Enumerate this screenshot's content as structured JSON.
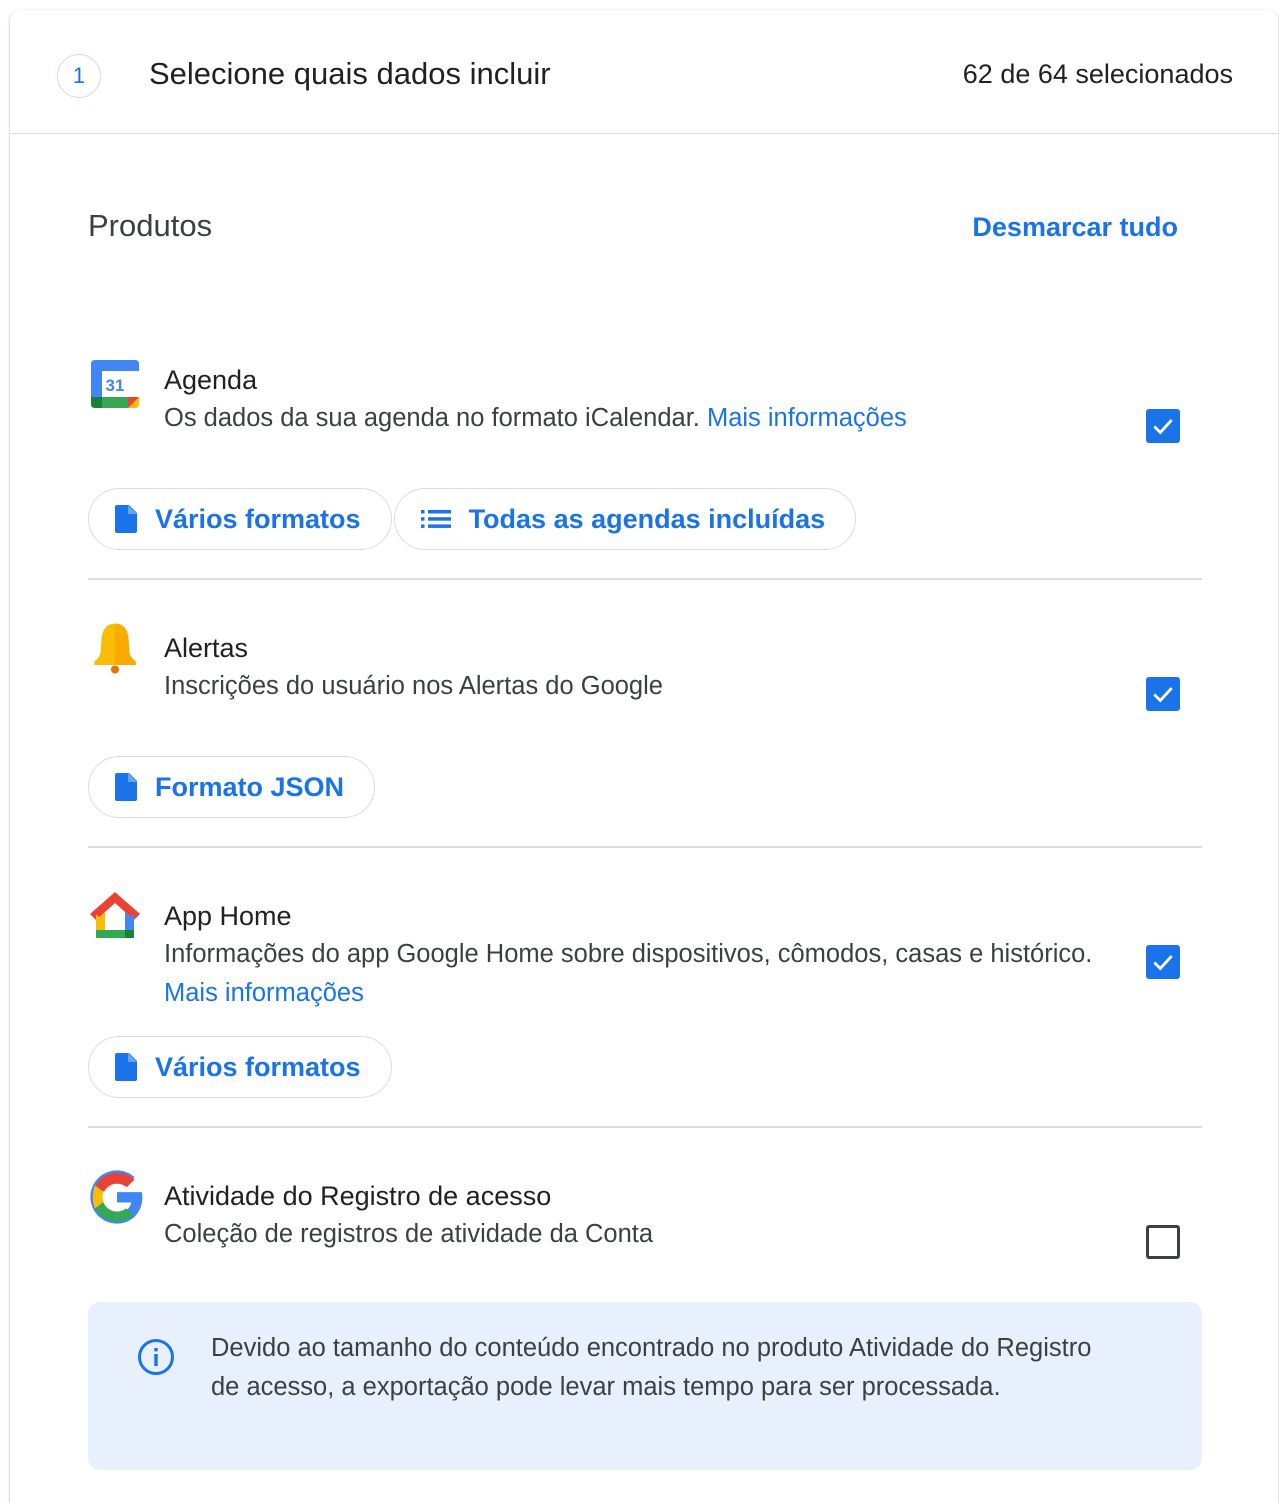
{
  "step": {
    "number": "1",
    "title": "Selecione quais dados incluir",
    "count": "62 de 64 selecionados"
  },
  "products_section": {
    "heading": "Produtos",
    "deselect_all": "Desmarcar tudo"
  },
  "products": [
    {
      "name": "Agenda",
      "description": "Os dados da sua agenda no formato iCalendar.",
      "more_info": "Mais informações",
      "checked": true,
      "icon": "google-calendar-icon",
      "icon_text": "31",
      "chips": [
        {
          "label": "Vários formatos",
          "icon": "file-icon"
        },
        {
          "label": "Todas as agendas incluídas",
          "icon": "list-icon"
        }
      ]
    },
    {
      "name": "Alertas",
      "description": "Inscrições do usuário nos Alertas do Google",
      "checked": true,
      "icon": "bell-icon",
      "chips": [
        {
          "label": "Formato JSON",
          "icon": "file-icon"
        }
      ]
    },
    {
      "name": "App Home",
      "description": "Informações do app Google Home sobre dispositivos, cômodos, casas e histórico.",
      "more_info": "Mais informações",
      "checked": true,
      "icon": "google-home-icon",
      "chips": [
        {
          "label": "Vários formatos",
          "icon": "file-icon"
        }
      ]
    },
    {
      "name": "Atividade do Registro de acesso",
      "description": "Coleção de registros de atividade da Conta",
      "checked": false,
      "icon": "google-g-icon",
      "chips": []
    }
  ],
  "notice": {
    "icon": "info-icon",
    "text": "Devido ao tamanho do conteúdo encontrado no produto Atividade do Registro de acesso, a exportação pode levar mais tempo para ser processada."
  },
  "colors": {
    "accent": "#1a73e8",
    "divider": "#dadce0",
    "notice_bg": "#e8f0fe"
  }
}
